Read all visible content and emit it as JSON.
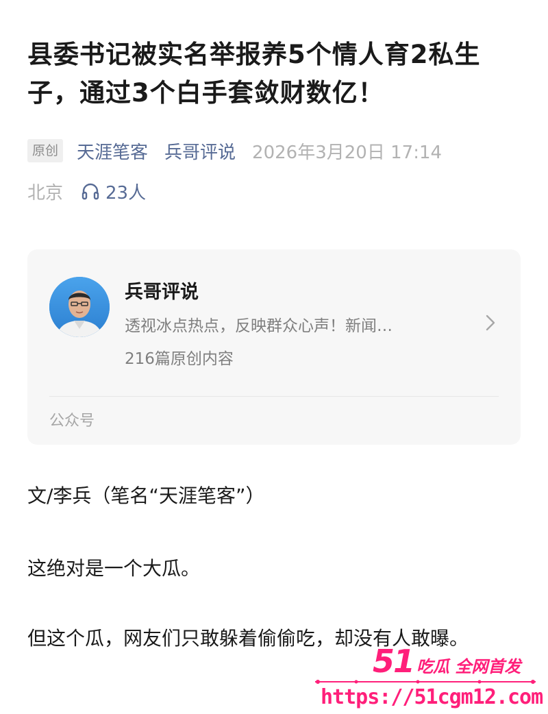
{
  "article": {
    "title": "县委书记被实名举报养5个情人育2私生子，通过3个白手套敛财数亿！",
    "original_tag": "原创",
    "author": "天涯笔客",
    "account": "兵哥评说",
    "date": "2026年3月20日 17:14",
    "location": "北京",
    "listen_count": "23人"
  },
  "account_card": {
    "name": "兵哥评说",
    "description": "透视冰点热点，反映群众心声！新闻…",
    "article_count": "216篇原创内容",
    "type_label": "公众号"
  },
  "body": {
    "paragraphs": [
      "文/李兵（笔名“天涯笔客”）",
      "这绝对是一个大瓜。",
      "但这个瓜，网友们只敢躲着偷偷吃，却没有人敢曝。"
    ]
  },
  "watermark": {
    "logo_number": "51",
    "logo_text": "吃瓜 全网首发",
    "url": "https://51cgm12.com"
  },
  "colors": {
    "link": "#576b95",
    "meta_gray": "#b2b2b2",
    "watermark_pink": "#ff1f7a",
    "card_bg": "#f7f7f7"
  },
  "icons": {
    "listen": "headphones-icon",
    "card_arrow": "chevron-right-icon",
    "avatar": "avatar"
  }
}
